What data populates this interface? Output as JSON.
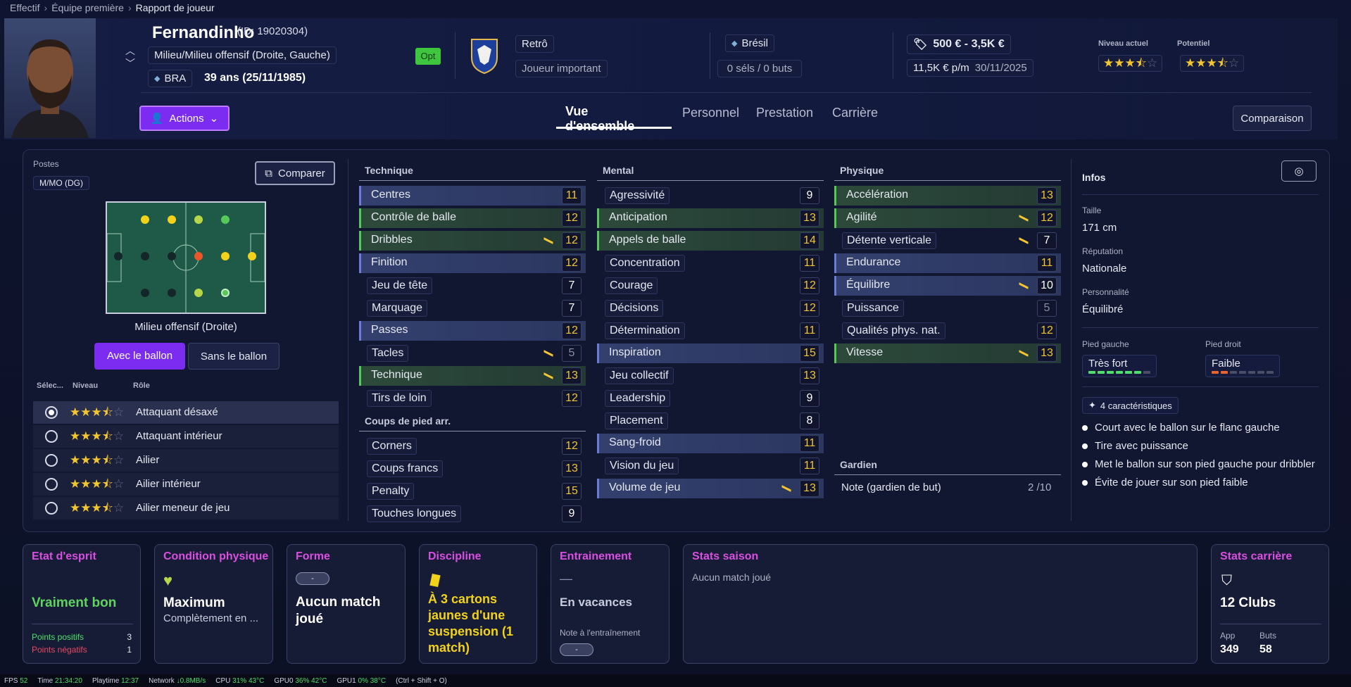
{
  "breadcrumb": {
    "items": [
      "Effectif",
      "Équipe première",
      "Rapport de joueur"
    ]
  },
  "player": {
    "name": "Fernandinho",
    "id": "(ID: 19020304)",
    "position": "Milieu/Milieu offensif (Droite, Gauche)",
    "nation_code": "BRA",
    "age": "39 ans (25/11/1985)",
    "opt_badge": "Opt",
    "club_role": "Retrô",
    "squad_status": "Joueur important",
    "nation": "Brésil",
    "caps": "0 séls / 0 buts",
    "value": "500 € - 3,5K €",
    "wage": "11,5K € p/m",
    "contract_end": "30/11/2025",
    "current_level_label": "Niveau actuel",
    "potential_label": "Potentiel",
    "current_stars": 3.5,
    "potential_stars": 3.5
  },
  "actions_label": "Actions",
  "tabs": [
    "Vue d'ensemble",
    "Personnel",
    "Prestation",
    "Carrière"
  ],
  "compare_button": "Comparaison",
  "positions": {
    "label": "Postes",
    "value": "M/MO (DG)",
    "compare": "Comparer",
    "pitch_caption": "Milieu offensif (Droite)",
    "with_ball": "Avec le ballon",
    "without_ball": "Sans le ballon",
    "col_select": "Sélec...",
    "col_level": "Niveau",
    "col_role": "Rôle",
    "roles": [
      {
        "name": "Attaquant désaxé",
        "stars": 3.5,
        "selected": true
      },
      {
        "name": "Attaquant intérieur",
        "stars": 3.5,
        "selected": false
      },
      {
        "name": "Ailier",
        "stars": 3.5,
        "selected": false
      },
      {
        "name": "Ailier intérieur",
        "stars": 3.5,
        "selected": false
      },
      {
        "name": "Ailier meneur de jeu",
        "stars": 3.5,
        "selected": false
      }
    ]
  },
  "technique": {
    "title": "Technique",
    "items": [
      {
        "name": "Centres",
        "value": "11",
        "hl": "blue"
      },
      {
        "name": "Contrôle de balle",
        "value": "12",
        "hl": "green"
      },
      {
        "name": "Dribbles",
        "value": "12",
        "hl": "green",
        "arrow": true
      },
      {
        "name": "Finition",
        "value": "12",
        "hl": "blue"
      },
      {
        "name": "Jeu de tête",
        "value": "7",
        "hl": ""
      },
      {
        "name": "Marquage",
        "value": "7",
        "hl": ""
      },
      {
        "name": "Passes",
        "value": "12",
        "hl": "blue"
      },
      {
        "name": "Tacles",
        "value": "5",
        "hl": "",
        "arrow": true
      },
      {
        "name": "Technique",
        "value": "13",
        "hl": "green",
        "arrow": true
      },
      {
        "name": "Tirs de loin",
        "value": "12",
        "hl": ""
      }
    ]
  },
  "setpieces": {
    "title": "Coups de pied arr.",
    "items": [
      {
        "name": "Corners",
        "value": "12",
        "hl": ""
      },
      {
        "name": "Coups francs",
        "value": "13",
        "hl": ""
      },
      {
        "name": "Penalty",
        "value": "15",
        "hl": ""
      },
      {
        "name": "Touches longues",
        "value": "9",
        "hl": ""
      }
    ]
  },
  "mental": {
    "title": "Mental",
    "items": [
      {
        "name": "Agressivité",
        "value": "9",
        "hl": ""
      },
      {
        "name": "Anticipation",
        "value": "13",
        "hl": "green"
      },
      {
        "name": "Appels de balle",
        "value": "14",
        "hl": "green"
      },
      {
        "name": "Concentration",
        "value": "11",
        "hl": ""
      },
      {
        "name": "Courage",
        "value": "12",
        "hl": ""
      },
      {
        "name": "Décisions",
        "value": "12",
        "hl": ""
      },
      {
        "name": "Détermination",
        "value": "11",
        "hl": ""
      },
      {
        "name": "Inspiration",
        "value": "15",
        "hl": "blue"
      },
      {
        "name": "Jeu collectif",
        "value": "13",
        "hl": ""
      },
      {
        "name": "Leadership",
        "value": "9",
        "hl": ""
      },
      {
        "name": "Placement",
        "value": "8",
        "hl": ""
      },
      {
        "name": "Sang-froid",
        "value": "11",
        "hl": "blue"
      },
      {
        "name": "Vision du jeu",
        "value": "11",
        "hl": ""
      },
      {
        "name": "Volume de jeu",
        "value": "13",
        "hl": "blue",
        "arrow": true
      }
    ]
  },
  "physique": {
    "title": "Physique",
    "items": [
      {
        "name": "Accélération",
        "value": "13",
        "hl": "green"
      },
      {
        "name": "Agilité",
        "value": "12",
        "hl": "green",
        "arrow": true
      },
      {
        "name": "Détente verticale",
        "value": "7",
        "hl": "",
        "arrow": true
      },
      {
        "name": "Endurance",
        "value": "11",
        "hl": "blue"
      },
      {
        "name": "Équilibre",
        "value": "10",
        "hl": "blue",
        "arrow": true
      },
      {
        "name": "Puissance",
        "value": "5",
        "hl": ""
      },
      {
        "name": "Qualités phys. nat.",
        "value": "12",
        "hl": ""
      },
      {
        "name": "Vitesse",
        "value": "13",
        "hl": "green",
        "arrow": true
      }
    ]
  },
  "goalkeeper": {
    "title": "Gardien",
    "label": "Note (gardien de but)",
    "value": "2 /10"
  },
  "infos": {
    "title": "Infos",
    "height_label": "Taille",
    "height": "171 cm",
    "reputation_label": "Réputation",
    "reputation": "Nationale",
    "personality_label": "Personnalité",
    "personality": "Équilibré",
    "left_foot_label": "Pied gauche",
    "left_foot": "Très fort",
    "right_foot_label": "Pied droit",
    "right_foot": "Faible",
    "left_foot_level": 6,
    "right_foot_level": 2,
    "traits_label": "4 caractéristiques",
    "traits": [
      "Court avec le ballon sur le flanc gauche",
      "Tire avec puissance",
      "Met le ballon sur son pied gauche pour dribbler",
      "Évite de jouer sur son pied faible"
    ]
  },
  "cards": {
    "morale": {
      "title": "Etat d'esprit",
      "value": "Vraiment bon",
      "pos_label": "Points positifs",
      "pos": "3",
      "neg_label": "Points négatifs",
      "neg": "1"
    },
    "condition": {
      "title": "Condition physique",
      "value": "Maximum",
      "sub": "Complètement en ..."
    },
    "form": {
      "title": "Forme",
      "badge": "-",
      "value": "Aucun match joué"
    },
    "discipline": {
      "title": "Discipline",
      "value": "À 3 cartons jaunes d'une suspension (1 match)"
    },
    "training": {
      "title": "Entrainement",
      "dash": "—",
      "value": "En vacances",
      "note_label": "Note à l'entraînement",
      "note": "-"
    },
    "season": {
      "title": "Stats saison",
      "value": "Aucun match joué"
    },
    "career": {
      "title": "Stats carrière",
      "value": "12 Clubs",
      "app_label": "App",
      "app": "349",
      "goals_label": "Buts",
      "goals": "58"
    }
  },
  "statusbar": {
    "fps_label": "FPS",
    "fps": "52",
    "time_label": "Time",
    "time": "21:34:20",
    "playtime_label": "Playtime",
    "playtime": "12:37",
    "network_label": "Network",
    "network": "↓0.8MB/s",
    "cpu_label": "CPU",
    "cpu": "31%",
    "cpu_temp": "43°C",
    "gpu0_label": "GPU0",
    "gpu0": "36%",
    "gpu0_temp": "42°C",
    "gpu1_label": "GPU1",
    "gpu1": "0%",
    "gpu1_temp": "38°C",
    "shortcut": "(Ctrl + Shift + O)"
  },
  "colors": {
    "accent": "#7b2cf0",
    "value_gold": "#f3c531",
    "green_hl": "#3d8f4a",
    "blue_hl": "#4a5a9e",
    "card_title": "#d94fe0"
  }
}
